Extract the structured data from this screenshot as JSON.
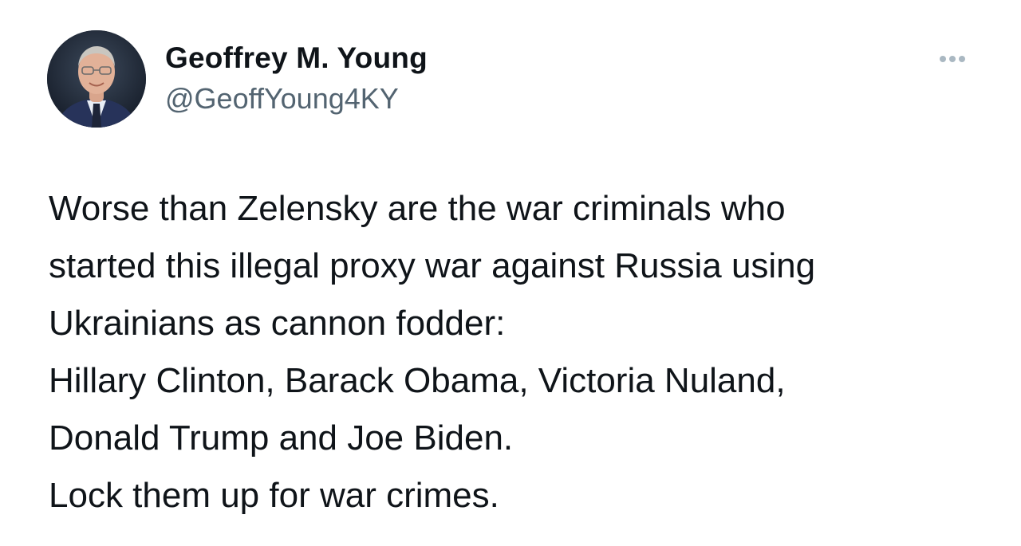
{
  "author": {
    "display_name": "Geoffrey M. Young",
    "handle": "@GeoffYoung4KY",
    "avatar_icon": "profile-photo"
  },
  "menu": {
    "icon": "more-options-icon"
  },
  "tweet": {
    "lines": [
      "Worse than Zelensky are the war criminals who",
      "started this illegal proxy war against Russia using",
      "Ukrainians as cannon fodder:",
      "Hillary Clinton, Barack Obama, Victoria Nuland,",
      "Donald Trump and Joe Biden.",
      "Lock them up for war crimes."
    ]
  },
  "colors": {
    "text": "#0f1419",
    "secondary": "#536471",
    "menu_dots": "#aab8c2",
    "background": "#ffffff"
  }
}
